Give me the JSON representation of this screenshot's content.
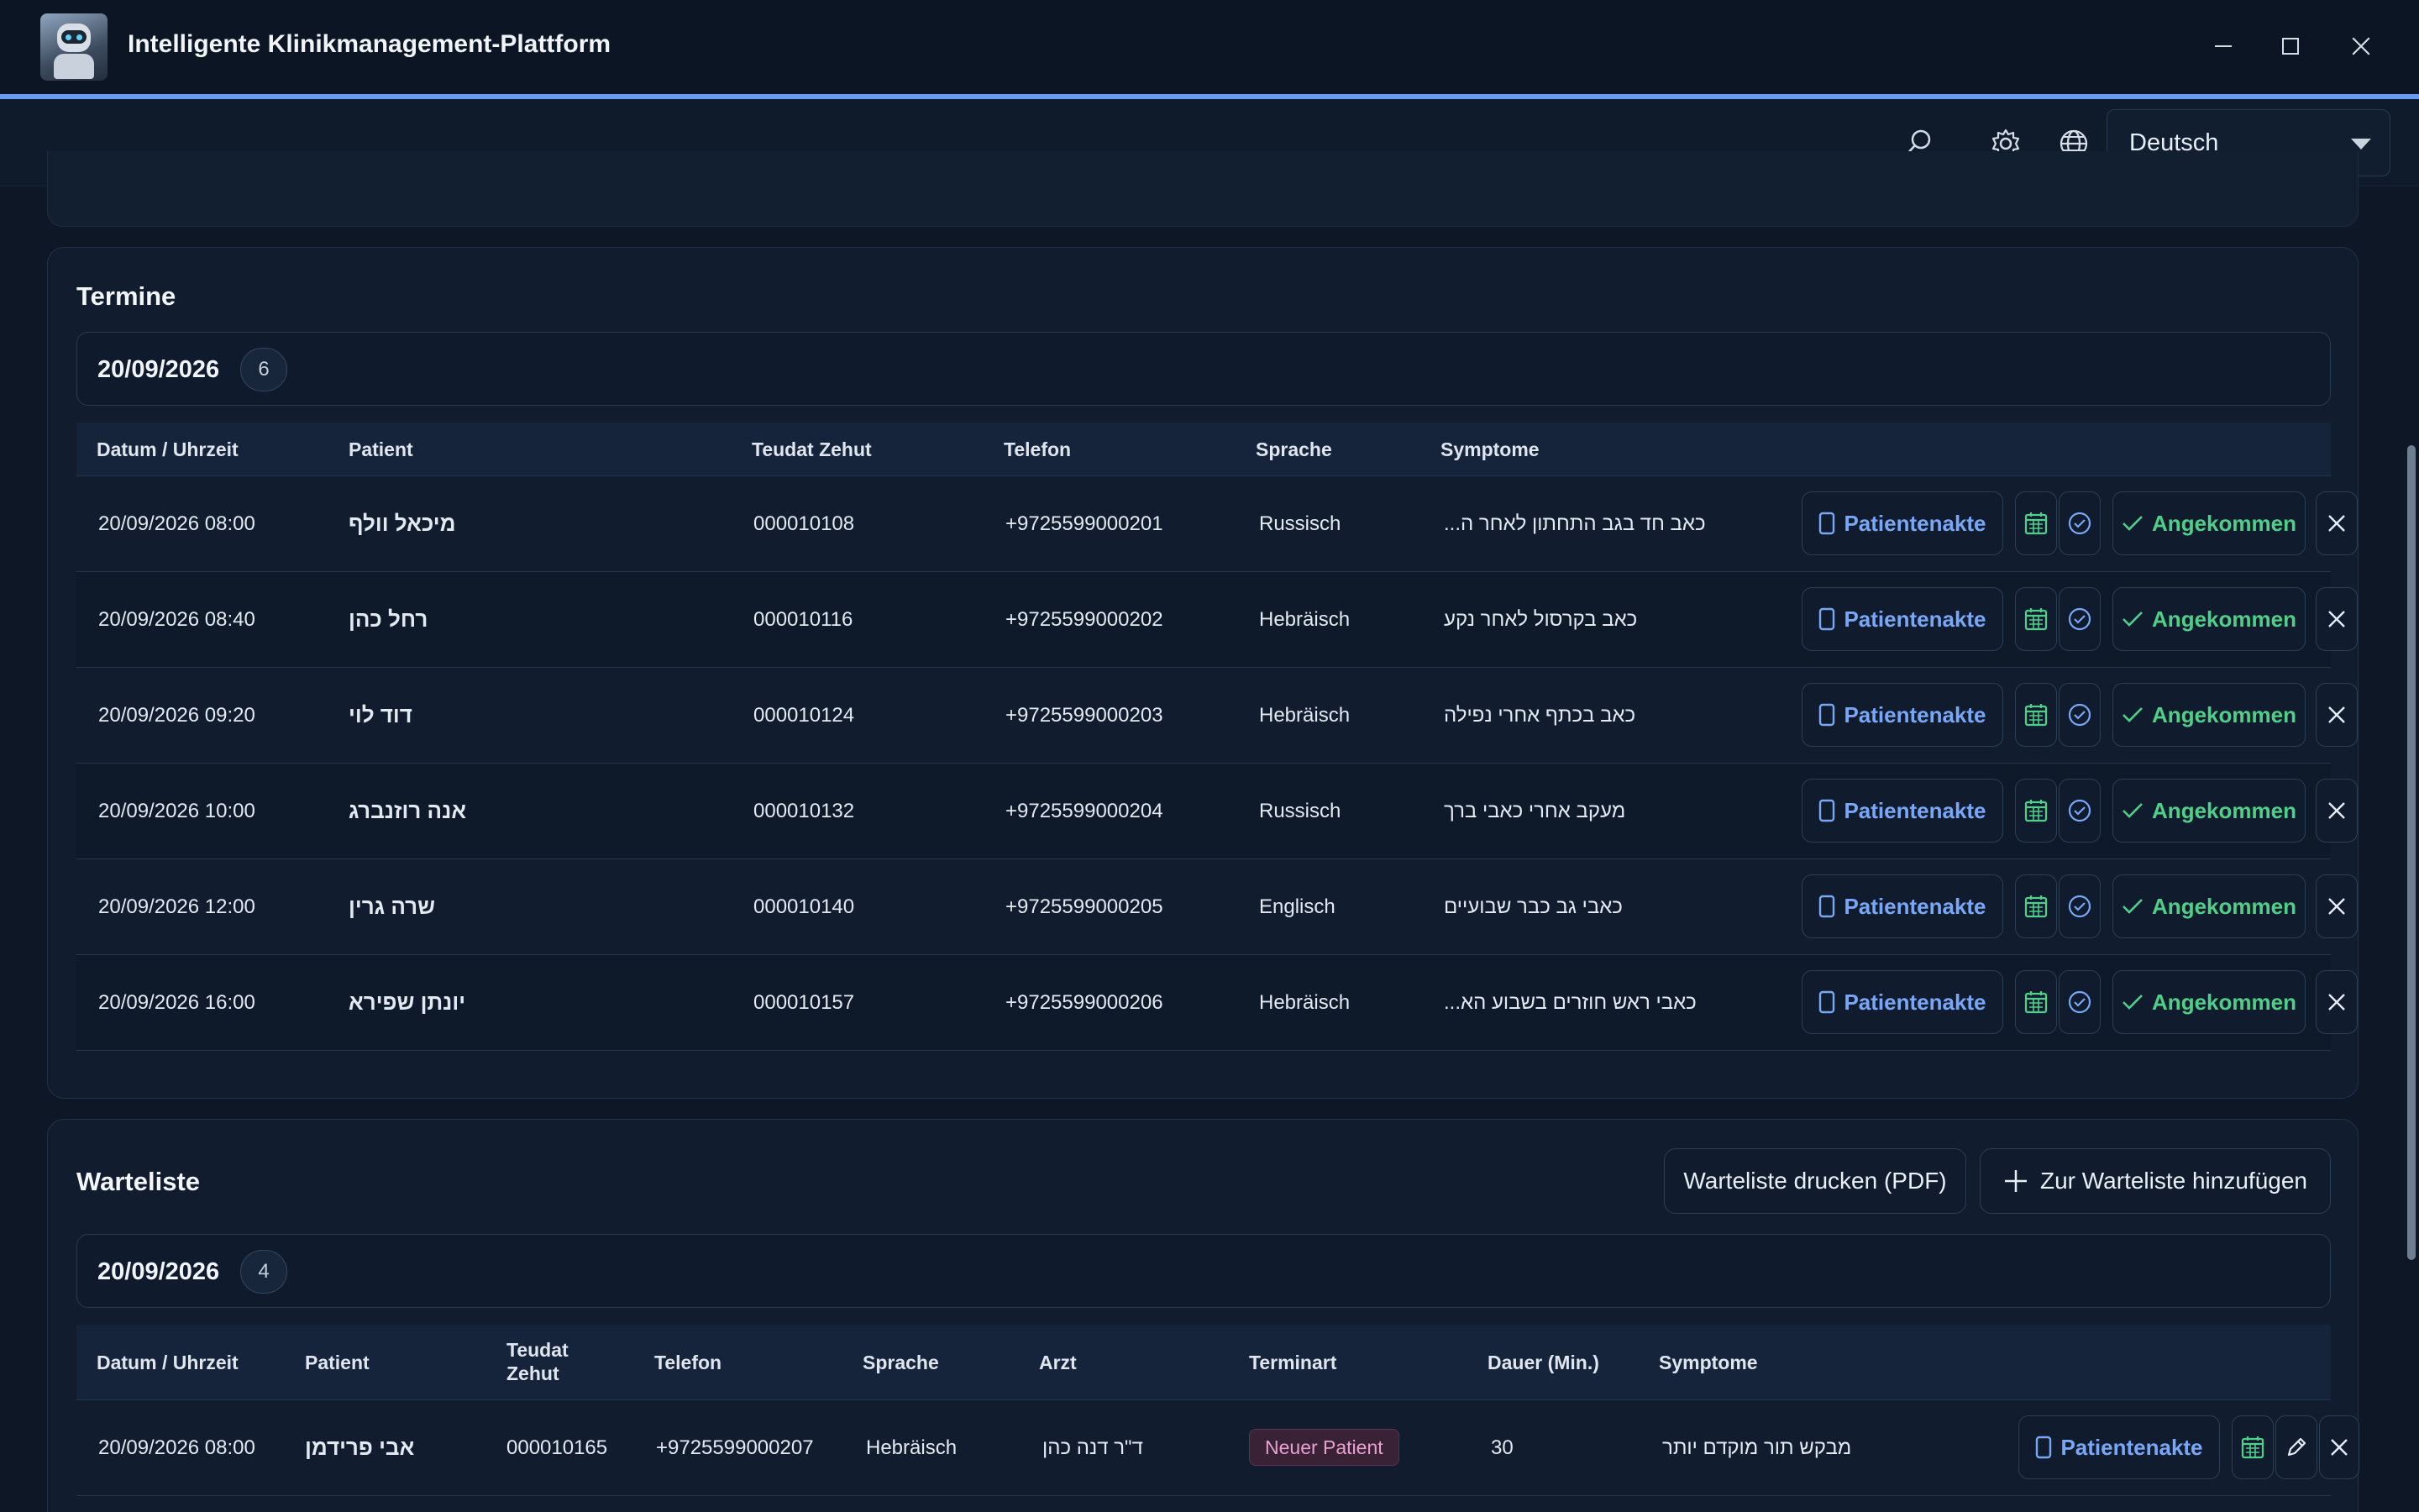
{
  "app": {
    "title": "Intelligente Klinikmanagement-Plattform",
    "window_controls": {
      "minimize": "—",
      "maximize": "☐",
      "close": "✕"
    }
  },
  "toolbar": {
    "icons": [
      "search-icon",
      "gear-icon",
      "globe-icon"
    ],
    "language": "Deutsch"
  },
  "colors": {
    "accent": "#6b9bf0",
    "link_blue": "#7aa7f5",
    "success_green": "#4fcf88",
    "calendar_green": "#4fcf88",
    "badge_pink": "#e7a0cf"
  },
  "appointments": {
    "title": "Termine",
    "date": "20/09/2026",
    "count": "6",
    "columns": [
      "Datum / Uhrzeit",
      "Patient",
      "Teudat Zehut",
      "Telefon",
      "Sprache",
      "Symptome"
    ],
    "rows": [
      {
        "datetime": "20/09/2026 08:00",
        "patient": "מיכאל וולף",
        "id": "000010108",
        "phone": "+9725599000201",
        "language": "Russisch",
        "symptoms": "כאב חד בגב התחתון לאחר ה..."
      },
      {
        "datetime": "20/09/2026 08:40",
        "patient": "רחל כהן",
        "id": "000010116",
        "phone": "+9725599000202",
        "language": "Hebräisch",
        "symptoms": "כאב בקרסול לאחר נקע"
      },
      {
        "datetime": "20/09/2026 09:20",
        "patient": "דוד לוי",
        "id": "000010124",
        "phone": "+9725599000203",
        "language": "Hebräisch",
        "symptoms": "כאב בכתף אחרי נפילה"
      },
      {
        "datetime": "20/09/2026 10:00",
        "patient": "אנה רוזנברג",
        "id": "000010132",
        "phone": "+9725599000204",
        "language": "Russisch",
        "symptoms": "מעקב אחרי כאבי ברך"
      },
      {
        "datetime": "20/09/2026 12:00",
        "patient": "שרה גרין",
        "id": "000010140",
        "phone": "+9725599000205",
        "language": "Englisch",
        "symptoms": "כאבי גב כבר שבועיים"
      },
      {
        "datetime": "20/09/2026 16:00",
        "patient": "יונתן שפירא",
        "id": "000010157",
        "phone": "+9725599000206",
        "language": "Hebräisch",
        "symptoms": "כאבי ראש חוזרים בשבוע הא..."
      }
    ],
    "actions": {
      "record": "Patientenakte",
      "arrived": "Angekommen"
    }
  },
  "waitlist": {
    "title": "Warteliste",
    "print_button": "Warteliste drucken (PDF)",
    "add_button": "Zur Warteliste hinzufügen",
    "date": "20/09/2026",
    "count": "4",
    "columns": [
      "Datum / Uhrzeit",
      "Patient",
      "Teudat Zehut",
      "Telefon",
      "Sprache",
      "Arzt",
      "Terminart",
      "Dauer (Min.)",
      "Symptome"
    ],
    "rows": [
      {
        "datetime": "20/09/2026 08:00",
        "patient": "אבי פרידמן",
        "id": "000010165",
        "phone": "+9725599000207",
        "language": "Hebräisch",
        "doctor": "ד\"ר דנה כהן",
        "type": "Neuer Patient",
        "duration": "30",
        "symptoms": "מבקש תור מוקדם יותר"
      }
    ],
    "actions": {
      "record": "Patientenakte"
    }
  }
}
